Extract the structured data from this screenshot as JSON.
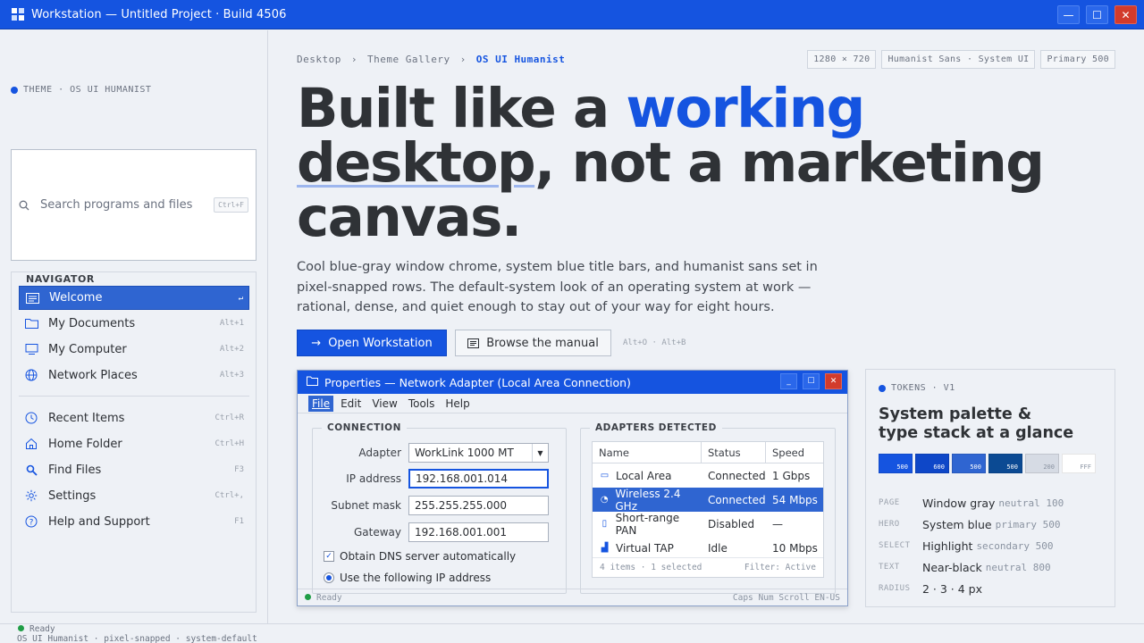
{
  "window": {
    "title": "Workstation — Untitled Project · Build 4506",
    "controls": [
      "minimize",
      "maximize",
      "close"
    ]
  },
  "sidebar": {
    "theme_label": "THEME · OS UI HUMANIST",
    "search": {
      "placeholder": "Search programs and files",
      "shortcut": "Ctrl+F"
    },
    "navigator": {
      "heading": "NAVIGATOR",
      "items": [
        {
          "label": "Welcome",
          "key": "↵",
          "icon": "document-icon",
          "active": true
        },
        {
          "label": "My Documents",
          "key": "Alt+1",
          "icon": "folder-icon"
        },
        {
          "label": "My Computer",
          "key": "Alt+2",
          "icon": "monitor-icon"
        },
        {
          "label": "Network Places",
          "key": "Alt+3",
          "icon": "globe-icon"
        }
      ],
      "items2": [
        {
          "label": "Recent Items",
          "key": "Ctrl+R",
          "icon": "clock-icon"
        },
        {
          "label": "Home Folder",
          "key": "Ctrl+H",
          "icon": "home-icon"
        },
        {
          "label": "Find Files",
          "key": "F3",
          "icon": "search-icon"
        },
        {
          "label": "Settings",
          "key": "Ctrl+,",
          "icon": "gear-icon"
        },
        {
          "label": "Help and Support",
          "key": "F1",
          "icon": "help-icon"
        }
      ]
    }
  },
  "main": {
    "breadcrumb": [
      "Desktop",
      "Theme Gallery",
      "OS UI Humanist"
    ],
    "tags": [
      "1280 × 720",
      "Humanist Sans · System UI",
      "Primary 500"
    ],
    "headline": {
      "part1": "Built like a ",
      "highlight": "working",
      "underlined": "desktop",
      "part2": ", not a marketing",
      "part3": "canvas."
    },
    "lede": "Cool blue-gray window chrome, system blue title bars, and humanist sans set in pixel-snapped rows. The default-system look of an operating system at work — rational, dense, and quiet enough to stay out of your way for eight hours.",
    "primary_button": "Open Workstation",
    "secondary_button": "Browse the manual",
    "shortcut_hint": "Alt+O · Alt+B"
  },
  "dialog": {
    "title": "Properties — Network Adapter (Local Area Connection)",
    "menu": [
      "File",
      "Edit",
      "View",
      "Tools",
      "Help"
    ],
    "connection": {
      "heading": "CONNECTION",
      "adapter_label": "Adapter",
      "adapter_value": "WorkLink 1000 MT",
      "ip_label": "IP address",
      "ip_value": "192.168.001.014",
      "subnet_label": "Subnet mask",
      "subnet_value": "255.255.255.000",
      "gateway_label": "Gateway",
      "gateway_value": "192.168.001.001",
      "dns_checkbox": "Obtain DNS server automatically",
      "ip_radio": "Use the following IP address"
    },
    "adapters": {
      "heading": "ADAPTERS DETECTED",
      "columns": [
        "Name",
        "Status",
        "Speed"
      ],
      "rows": [
        {
          "name": "Local Area",
          "status": "Connected",
          "speed": "1 Gbps",
          "icon": "ethernet-icon"
        },
        {
          "name": "Wireless 2.4 GHz",
          "status": "Connected",
          "speed": "54 Mbps",
          "icon": "wifi-icon",
          "selected": true
        },
        {
          "name": "Short-range PAN",
          "status": "Disabled",
          "speed": "—",
          "icon": "bluetooth-icon"
        },
        {
          "name": "Virtual TAP",
          "status": "Idle",
          "speed": "10 Mbps",
          "icon": "chart-icon"
        }
      ],
      "footer_left": "4 items · 1 selected",
      "footer_right": "Filter: Active"
    },
    "status_left": "Ready",
    "status_right": "Caps  Num  Scroll  EN-US"
  },
  "tokens": {
    "label": "TOKENS · V1",
    "title_line1": "System palette &",
    "title_line2": "type stack at a glance",
    "swatches": [
      {
        "label": "500",
        "color": "#1554e0"
      },
      {
        "label": "600",
        "color": "#0e47c8"
      },
      {
        "label": "500",
        "color": "#2f65d1"
      },
      {
        "label": "500",
        "color": "#0b4a93"
      },
      {
        "label": "200",
        "color": "#d6dbe4"
      },
      {
        "label": "FFF",
        "color": "#ffffff"
      }
    ],
    "rows": [
      {
        "key": "PAGE",
        "value": "Window gray",
        "sub": "neutral 100"
      },
      {
        "key": "HERO",
        "value": "System blue",
        "sub": "primary 500"
      },
      {
        "key": "SELECT",
        "value": "Highlight",
        "sub": "secondary 500"
      },
      {
        "key": "TEXT",
        "value": "Near-black",
        "sub": "neutral 800"
      },
      {
        "key": "RADIUS",
        "value": "2 · 3 · 4 px",
        "sub": ""
      }
    ]
  },
  "statusbar": {
    "line1": "Ready",
    "line2": "OS UI Humanist · pixel-snapped · system-default"
  }
}
